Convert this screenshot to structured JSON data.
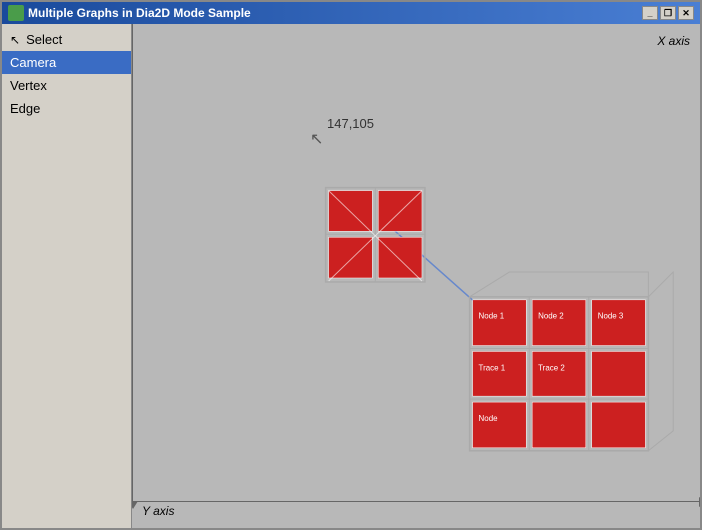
{
  "window": {
    "title": "Multiple Graphs in Dia2D Mode Sample",
    "close_btn": "✕",
    "restore_btn": "❐",
    "minimize_btn": "_"
  },
  "sidebar": {
    "items": [
      {
        "id": "select",
        "label": "Select",
        "active": false,
        "icon": "cursor"
      },
      {
        "id": "camera",
        "label": "Camera",
        "active": true,
        "icon": ""
      },
      {
        "id": "vertex",
        "label": "Vertex",
        "active": false,
        "icon": ""
      },
      {
        "id": "edge",
        "label": "Edge",
        "active": false,
        "icon": ""
      }
    ]
  },
  "canvas": {
    "x_axis_label": "X axis",
    "y_axis_label": "Y axis",
    "coordinates": "147,105",
    "bg_color": "#b8b8b8"
  }
}
